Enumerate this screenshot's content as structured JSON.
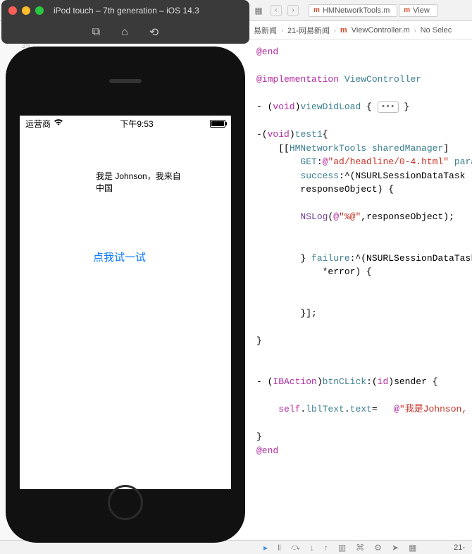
{
  "simulator": {
    "title": "iPod touch – 7th generation – iOS 14.3",
    "toolbar_icons": {
      "screenshot": "camera-icon",
      "home": "home-icon",
      "rotate": "rotate-icon"
    },
    "statusbar": {
      "carrier": "运营商",
      "time": "下午9:53"
    },
    "app": {
      "label_text": "我是 Johnson，我来自中国",
      "button_text": "点我试一试"
    }
  },
  "xcode": {
    "tabs": [
      {
        "prefix": "m",
        "name": "HMNetworkTools.m"
      },
      {
        "prefix": "m",
        "name": "View"
      }
    ],
    "breadcrumb": {
      "proj": "易新闻",
      "folder": "21-网易新闻",
      "file": "ViewController.m",
      "symbol": "No Selec"
    },
    "sidebar_project": "21-网易新闻",
    "gutter_line": "35",
    "code": {
      "end1": "@end",
      "impl_kw": "@implementation",
      "impl_cls": "ViewController",
      "m1_sig_pre": "- (",
      "m1_void": "void",
      "m1_sig_post": ")",
      "m1_name": "viewDidLoad",
      "m1_brace": " {",
      "m1_ellipsis": "•••",
      "m1_close": "}",
      "m2_sig_pre": "-(",
      "m2_void": "void",
      "m2_sig_post": ")",
      "m2_name": "test1",
      "m2_brace": "{",
      "call_open": "    [[",
      "call_cls": "HMNetworkTools",
      "call_sp": " ",
      "call_shared": "sharedManager",
      "call_close": "]",
      "get_label": "        GET",
      "get_colon": ":",
      "get_at": "@",
      "get_str": "\"ad/headline/0-4.html\"",
      "get_param": " parame",
      "succ_label": "        success",
      "succ_rest": ":^(NSURLSessionDataTask *ta",
      "resp_line": "        responseObject) {",
      "nslog_pre": "        NSLog",
      "nslog_open": "(",
      "nslog_at": "@",
      "nslog_fmt": "\"%@\"",
      "nslog_rest": ",responseObject);",
      "fail_pre": "        } ",
      "fail_kw": "failure",
      "fail_rest": ":^(NSURLSessionDataTask *",
      "err_line": "            *error) {",
      "tail_close": "        }];",
      "m2_end": "}",
      "m3_pre": "- (",
      "m3_ib": "IBAction",
      "m3_mid": ")",
      "m3_name": "btnCLick",
      "m3_colon": ":(",
      "m3_id": "id",
      "m3_rest": ")sender {",
      "assign_self": "    self",
      "assign_dot1": ".",
      "assign_lbl": "lblText",
      "assign_dot2": ".",
      "assign_text": "text",
      "assign_eq": "=   ",
      "assign_at": "@",
      "assign_str": "\"我是Johnson, 我来自",
      "m3_end": "}",
      "end2": "@end"
    },
    "debug_crumb": "21-"
  }
}
